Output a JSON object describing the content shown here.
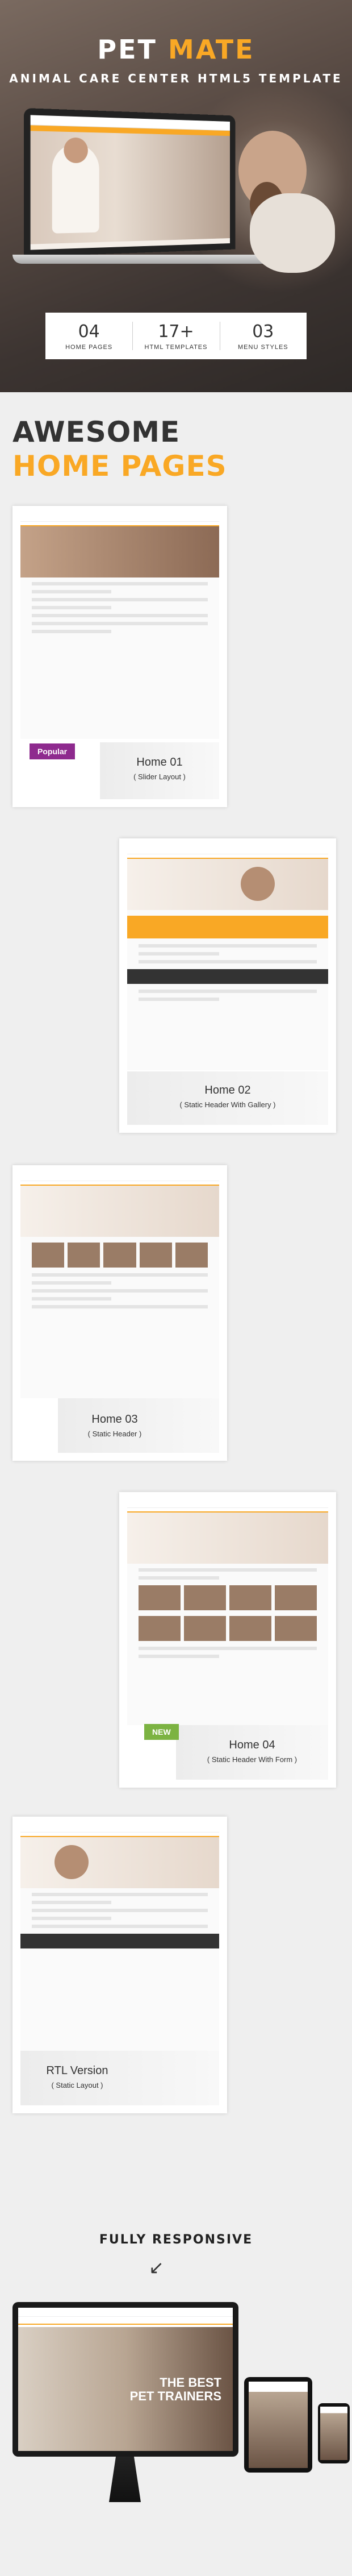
{
  "hero": {
    "title_main": "PET",
    "title_accent": "MATE",
    "subtitle": "ANIMAL CARE CENTER HTML5 TEMPLATE"
  },
  "stats": [
    {
      "num": "04",
      "label": "HOME PAGES"
    },
    {
      "num": "17+",
      "label": "HTML TEMPLATES"
    },
    {
      "num": "03",
      "label": "MENU STYLES"
    }
  ],
  "section": {
    "line1": "AWESOME",
    "line2": "HOME PAGES"
  },
  "cards": [
    {
      "name": "Home 01",
      "sub": "( Slider Layout )",
      "badge": "Popular"
    },
    {
      "name": "Home 02",
      "sub": "( Static Header With Gallery )"
    },
    {
      "name": "Home 03",
      "sub": "( Static Header )"
    },
    {
      "name": "Home 04",
      "sub": "( Static Header With Form )",
      "badge": "NEW"
    },
    {
      "name": "RTL Version",
      "sub": "( Static Layout )"
    }
  ],
  "responsive": {
    "title": "FULLY RESPONSIVE",
    "arrow": "↙",
    "screen_text": "THE BEST\nPET TRAINERS"
  },
  "colors": {
    "accent": "#f9a825",
    "popular": "#8e2a8e",
    "new": "#7cb342"
  }
}
